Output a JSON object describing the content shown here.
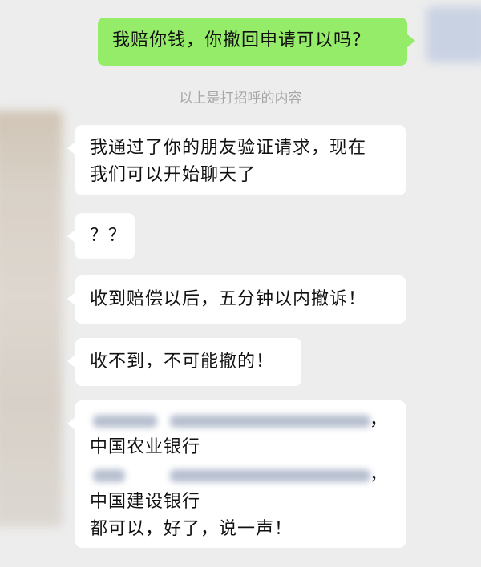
{
  "chat": {
    "outgoing": {
      "text": "我赔你钱，你撤回申请可以吗？"
    },
    "system_note": "以上是打招呼的内容",
    "incoming": [
      {
        "lines": [
          "我通过了你的朋友验证请求，现在",
          "我们可以开始聊天了"
        ]
      },
      {
        "lines": [
          "？？"
        ]
      },
      {
        "lines": [
          "收到赔偿以后，五分钟以内撤诉！"
        ]
      },
      {
        "lines": [
          "收不到，不可能撤的！"
        ]
      },
      {
        "redacted_line_1_suffix": "，",
        "bank_1": "中国农业银行",
        "redacted_line_2_suffix": "，",
        "bank_2": "中国建设银行",
        "closing": "都可以，好了，说一声！"
      }
    ]
  },
  "colors": {
    "background": "#ededed",
    "outgoing_bubble": "#95ec69",
    "incoming_bubble": "#ffffff",
    "system_text": "#a6a6a6"
  }
}
